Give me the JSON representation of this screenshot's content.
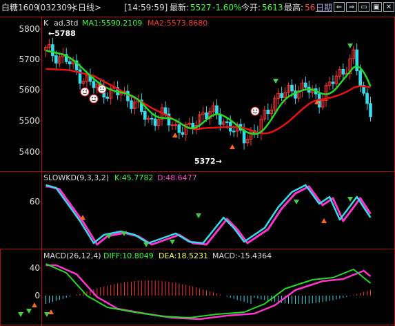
{
  "header": {
    "title": "白糖1609",
    "code": "(032309)",
    "period": "<日线>",
    "time": "[14:59:59]",
    "latest_label": "最新:",
    "latest_value": "5527",
    "change": "-1.60%",
    "open_label": "今开:",
    "open_value": "5613",
    "high_label": "最高:",
    "high_value": "56",
    "period_btn": "日期",
    "buttons": [
      "⇐",
      "⇒",
      "▭",
      "▣",
      "✕"
    ]
  },
  "main": {
    "k_label": "K",
    "formula": "ad.3td",
    "ma1": "MA1:5590.2109",
    "ma2": "MA2:5573.8680",
    "high_marker": "←5788",
    "low_marker": "5372→",
    "y_ticks": [
      "5800",
      "5700",
      "5600",
      "5500",
      "5400"
    ]
  },
  "kd": {
    "name": "SLOWKD(9,3,3,2)",
    "k": "K:45.7782",
    "d": "D:48.6477",
    "y_ticks": [
      "60"
    ]
  },
  "macd": {
    "name": "MACD(26,12,4)",
    "diff": "DIFF:10.8049",
    "dea": "DEA:18.5231",
    "macd": "MACD:-15.4364",
    "y_ticks": [
      "40",
      "0"
    ]
  },
  "colors": {
    "up": "#ff3333",
    "down": "#33ddee",
    "ma_green": "#22dd22",
    "ma_red": "#ee1111",
    "magenta": "#ff33cc",
    "grid_red": "#aa1111",
    "header_green": "#33ff33",
    "header_red": "#ff4444"
  }
}
